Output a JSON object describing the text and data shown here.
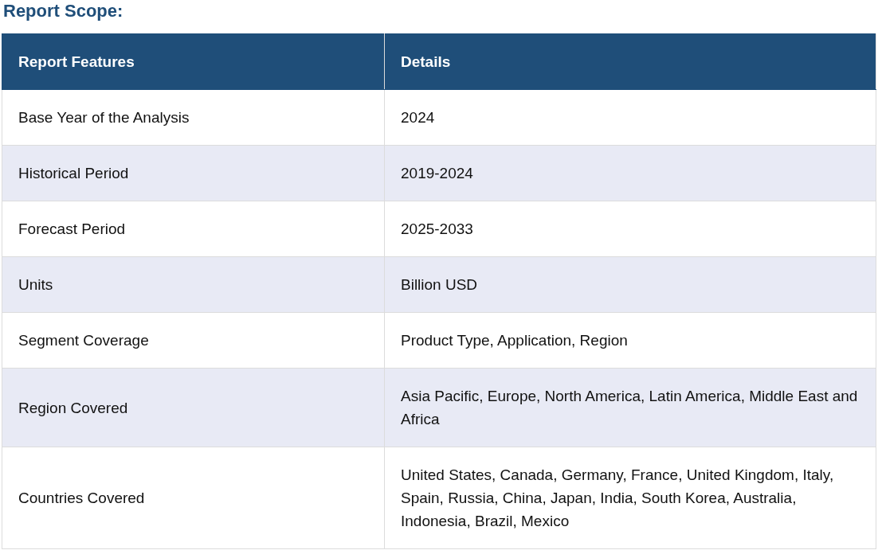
{
  "title": "Report Scope:",
  "table": {
    "columns": [
      "Report Features",
      "Details"
    ],
    "rows": [
      {
        "feature": "Base Year of the Analysis",
        "details": "2024"
      },
      {
        "feature": "Historical Period",
        "details": "2019-2024"
      },
      {
        "feature": "Forecast Period",
        "details": "2025-2033"
      },
      {
        "feature": "Units",
        "details": "Billion USD"
      },
      {
        "feature": "Segment Coverage",
        "details": "Product Type, Application, Region"
      },
      {
        "feature": "Region Covered",
        "details": "Asia Pacific, Europe, North America, Latin America, Middle East and Africa"
      },
      {
        "feature": "Countries Covered",
        "details": "United States, Canada, Germany, France, United Kingdom, Italy, Spain, Russia, China, Japan, India, South Korea, Australia, Indonesia, Brazil, Mexico"
      }
    ]
  }
}
